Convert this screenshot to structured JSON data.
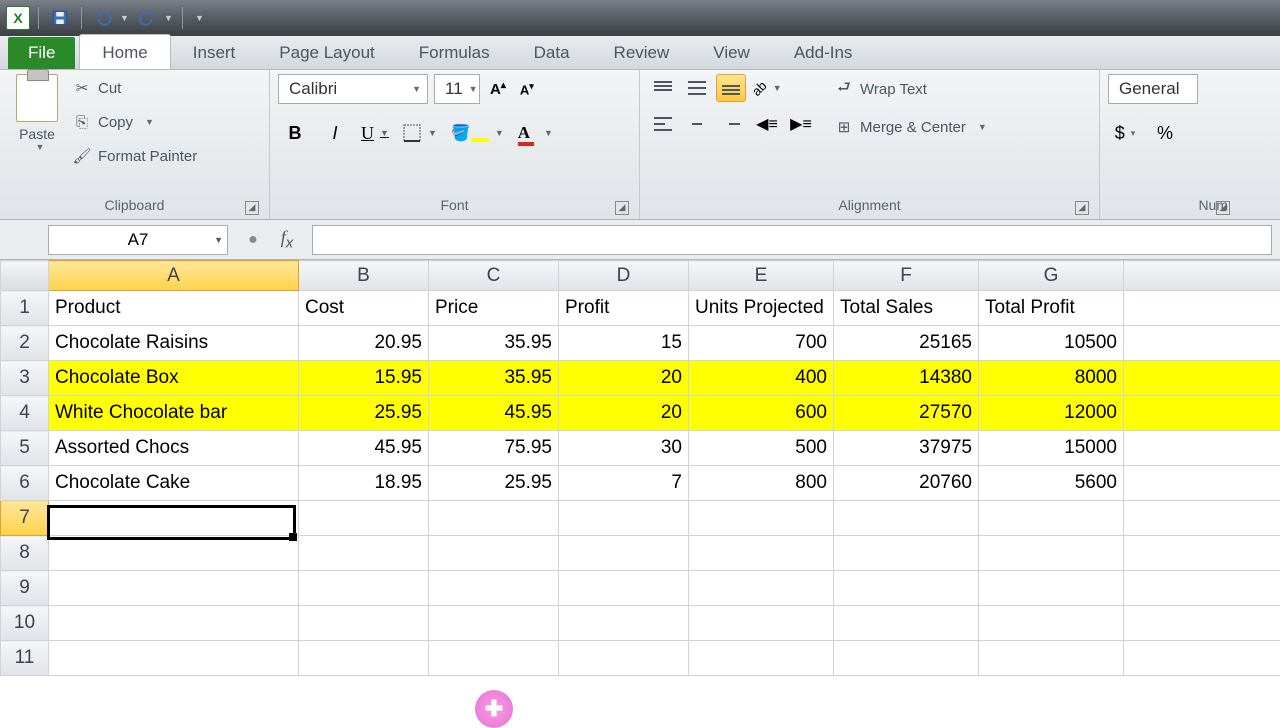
{
  "qat": {
    "save": "save",
    "undo": "undo",
    "redo": "redo"
  },
  "tabs": {
    "file": "File",
    "home": "Home",
    "insert": "Insert",
    "page_layout": "Page Layout",
    "formulas": "Formulas",
    "data": "Data",
    "review": "Review",
    "view": "View",
    "addins": "Add-Ins"
  },
  "ribbon": {
    "clipboard": {
      "title": "Clipboard",
      "paste": "Paste",
      "cut": "Cut",
      "copy": "Copy",
      "format_painter": "Format Painter"
    },
    "font": {
      "title": "Font",
      "name": "Calibri",
      "size": "11"
    },
    "alignment": {
      "title": "Alignment",
      "wrap": "Wrap Text",
      "merge": "Merge & Center"
    },
    "number": {
      "title": "Num",
      "format": "General"
    }
  },
  "formula_bar": {
    "cell_ref": "A7",
    "formula": ""
  },
  "sheet": {
    "columns": [
      "A",
      "B",
      "C",
      "D",
      "E",
      "F",
      "G"
    ],
    "headers": [
      "Product",
      "Cost",
      "Price",
      "Profit",
      "Units Projected",
      "Total Sales",
      "Total Profit"
    ],
    "rows": [
      {
        "n": 1,
        "hl": false,
        "cells": [
          "Product",
          "Cost",
          "Price",
          "Profit",
          "Units Projected",
          "Total Sales",
          "Total Profit"
        ],
        "types": [
          "txt",
          "txt",
          "txt",
          "txt",
          "txt",
          "txt",
          "txt"
        ]
      },
      {
        "n": 2,
        "hl": false,
        "cells": [
          "Chocolate Raisins",
          "20.95",
          "35.95",
          "15",
          "700",
          "25165",
          "10500"
        ],
        "types": [
          "txt",
          "num",
          "num",
          "num",
          "num",
          "num",
          "num"
        ]
      },
      {
        "n": 3,
        "hl": true,
        "cells": [
          "Chocolate Box",
          "15.95",
          "35.95",
          "20",
          "400",
          "14380",
          "8000"
        ],
        "types": [
          "txt",
          "num",
          "num",
          "num",
          "num",
          "num",
          "num"
        ]
      },
      {
        "n": 4,
        "hl": true,
        "cells": [
          "White Chocolate bar",
          "25.95",
          "45.95",
          "20",
          "600",
          "27570",
          "12000"
        ],
        "types": [
          "txt",
          "num",
          "num",
          "num",
          "num",
          "num",
          "num"
        ]
      },
      {
        "n": 5,
        "hl": false,
        "cells": [
          "Assorted Chocs",
          "45.95",
          "75.95",
          "30",
          "500",
          "37975",
          "15000"
        ],
        "types": [
          "txt",
          "num",
          "num",
          "num",
          "num",
          "num",
          "num"
        ]
      },
      {
        "n": 6,
        "hl": false,
        "cells": [
          "Chocolate Cake",
          "18.95",
          "25.95",
          "7",
          "800",
          "20760",
          "5600"
        ],
        "types": [
          "txt",
          "num",
          "num",
          "num",
          "num",
          "num",
          "num"
        ]
      }
    ],
    "empty_rows": [
      7,
      8,
      9,
      10,
      11
    ],
    "active_cell": "A7",
    "selected_col": "A",
    "selected_row": 7
  }
}
